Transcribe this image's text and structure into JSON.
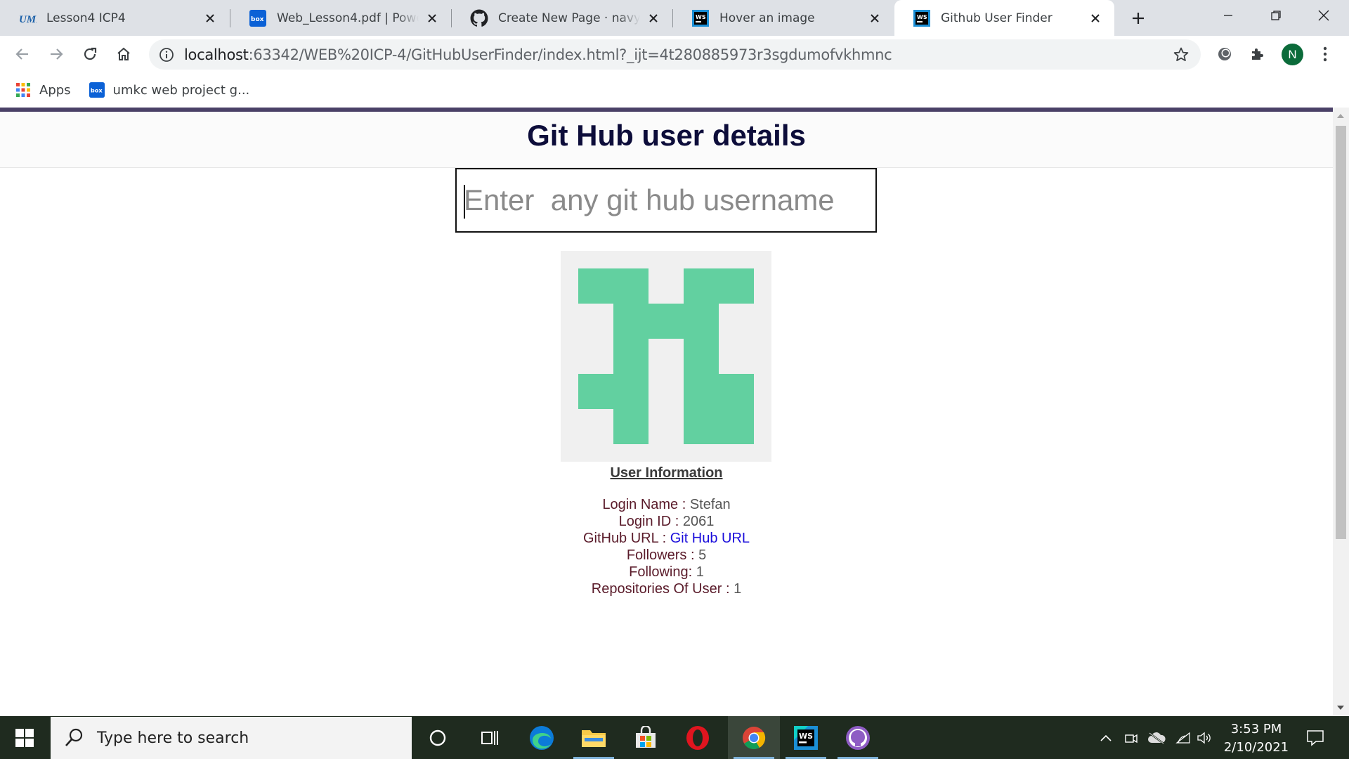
{
  "browser": {
    "tabs": [
      {
        "title": "Lesson4 ICP4",
        "favicon": "umkc-logo-icon"
      },
      {
        "title": "Web_Lesson4.pdf | Powered by Box",
        "favicon": "box-icon"
      },
      {
        "title": "Create New Page · navyaweb",
        "favicon": "github-icon"
      },
      {
        "title": "Hover an image",
        "favicon": "webstorm-icon"
      },
      {
        "title": "Github User Finder",
        "favicon": "webstorm-icon",
        "active": true
      }
    ],
    "url_host": "localhost",
    "url_path": ":63342/WEB%20ICP-4/GitHubUserFinder/index.html?_ijt=4t280885973r3sgdumofvkhmnc",
    "profile_initial": "N",
    "bookmarks": [
      {
        "label": "Apps",
        "icon": "apps-grid-icon"
      },
      {
        "label": "umkc web project g...",
        "icon": "box-icon"
      }
    ]
  },
  "page": {
    "title": "Git Hub user details",
    "search_placeholder": "Enter  any git hub username",
    "info_title": "User Information",
    "fields": {
      "login_name_label": "Login Name : ",
      "login_name_value": "Stefan",
      "login_id_label": "Login ID : ",
      "login_id_value": "2061",
      "github_url_label": "GitHub URL : ",
      "github_url_value": "Git Hub URL",
      "followers_label": "Followers : ",
      "followers_value": "5",
      "following_label": "Following: ",
      "following_value": "1",
      "repos_label": "Repositories Of User : ",
      "repos_value": "1"
    },
    "identicon_color": "#62d0a0",
    "identicon_bg": "#f0f0f0"
  },
  "taskbar": {
    "search_placeholder": "Type here to search",
    "time": "3:53 PM",
    "date": "2/10/2021"
  }
}
